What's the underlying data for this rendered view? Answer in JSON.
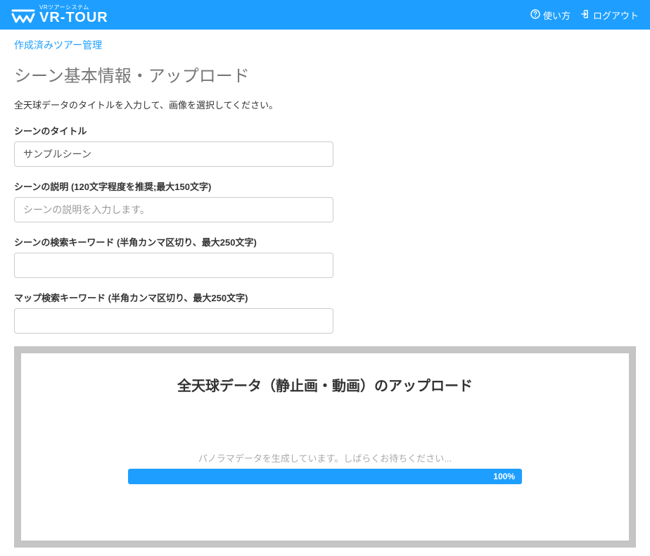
{
  "header": {
    "tagline": "VRツアーシステム",
    "brand": "VR-TOUR",
    "help_label": "使い方",
    "logout_label": "ログアウト"
  },
  "breadcrumb": "作成済みツアー管理",
  "page_title": "シーン基本情報・アップロード",
  "instruction": "全天球データのタイトルを入力して、画像を選択してください。",
  "fields": {
    "title": {
      "label": "シーンのタイトル",
      "value": "サンプルシーン"
    },
    "description": {
      "label": "シーンの説明 (120文字程度を推奨;最大150文字)",
      "placeholder": "シーンの説明を入力します。"
    },
    "keywords": {
      "label": "シーンの検索キーワード (半角カンマ区切り、最大250文字)"
    },
    "map_keywords": {
      "label": "マップ検索キーワード (半角カンマ区切り、最大250文字)"
    }
  },
  "upload": {
    "title": "全天球データ（静止画・動画）のアップロード",
    "progress_message": "パノラマデータを生成しています。しばらくお待ちください...",
    "progress_percent": "100%"
  }
}
